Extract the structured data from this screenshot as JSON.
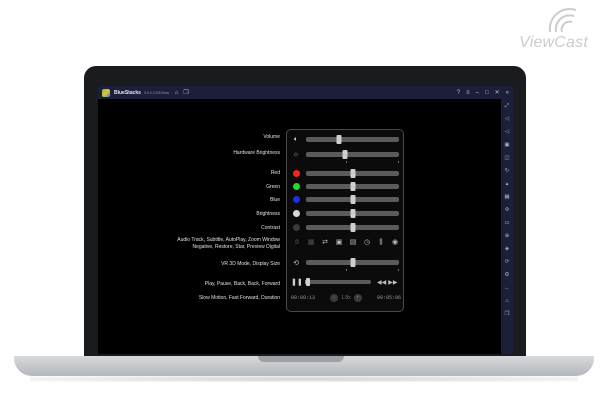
{
  "brand": {
    "name": "ViewCast",
    "icon": "wifi-waves-icon"
  },
  "titlebar": {
    "app_name": "BlueStacks",
    "version_label": "5.8.0.1028 Beta",
    "home_icon": "home-icon",
    "multi_icon": "multi-instance-icon",
    "right_icons": [
      "help-icon",
      "menu-icon",
      "minimize-icon",
      "restore-icon",
      "close-icon",
      "collapse-icon"
    ]
  },
  "sidebar": {
    "icons": [
      "fullscreen-icon",
      "volume-up-icon",
      "volume-down-icon",
      "screen-icon",
      "camera-icon",
      "rotate-icon",
      "shake-icon",
      "screenshot-icon",
      "gamepad-icon",
      "folder-icon",
      "macro-icon",
      "layers-icon",
      "sync-icon",
      "settings-icon",
      "back-icon",
      "home-icon",
      "recents-icon"
    ]
  },
  "labels": {
    "volume": "Volume",
    "hardware_brightness": "Hardware Brightness",
    "red": "Red",
    "green": "Green",
    "blue": "Blue",
    "brightness": "Brightness",
    "contrast": "Contrast",
    "toolbar_line1": "Audio Track, Subtitle, AutoPlay, Zoom Window",
    "toolbar_line2": "Negative, Restore, Star, Preview Digital",
    "vr": "VR 3D Mode, Display Size",
    "play": "Play, Pause, Back, Back, Forward",
    "slow": "Slow Motion, Fast Forward, Duration"
  },
  "panel": {
    "volume_level": 0.35,
    "hardware_brightness_level": 0.42,
    "red_level": 0.5,
    "green_level": 0.5,
    "blue_level": 0.5,
    "brightness_level": 0.5,
    "contrast_level": 0.5,
    "vr_level": 0.5,
    "progress": 0.02,
    "colors": {
      "red": "#ff2020",
      "green": "#22dd22",
      "blue": "#1e2ee6",
      "brightness": "#d8d8d8",
      "contrast": "#3a3a3a"
    },
    "toolbar_icons": [
      "hand-icon",
      "audio-track-icon",
      "repeat-icon",
      "subtitle-icon",
      "document-icon",
      "timer-icon",
      "equalizer-icon",
      "eye-icon"
    ],
    "current_time": "00:00:13",
    "speed": "1.8x",
    "duration": "00:05:06"
  }
}
